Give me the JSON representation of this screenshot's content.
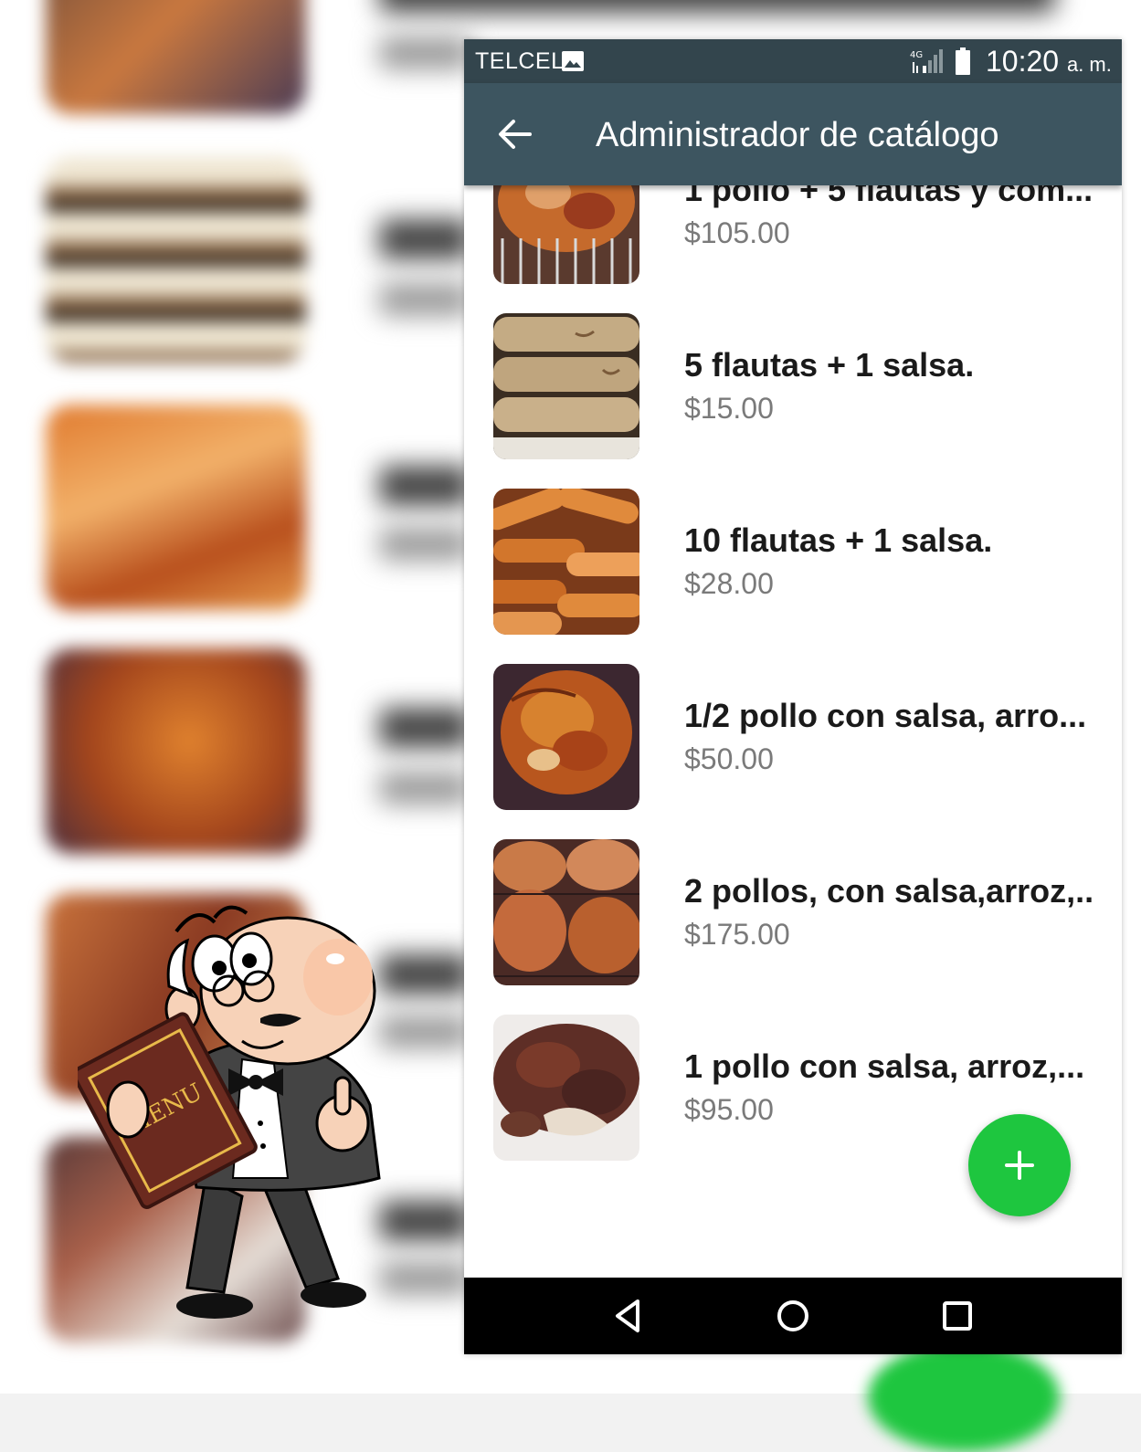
{
  "status_bar": {
    "carrier": "TELCEL",
    "network": "4G",
    "time": "10:20",
    "ampm": "a. m."
  },
  "app_bar": {
    "title": "Administrador de catálogo"
  },
  "catalog": [
    {
      "name": "1 pollo + 5 flautas y com...",
      "price": "$105.00",
      "thumb": "grilled-chicken"
    },
    {
      "name": "5 flautas + 1 salsa.",
      "price": "$15.00",
      "thumb": "flautas"
    },
    {
      "name": "10 flautas + 1 salsa.",
      "price": "$28.00",
      "thumb": "fried-flautas"
    },
    {
      "name": "1/2 pollo con salsa, arro...",
      "price": "$50.00",
      "thumb": "half-chicken"
    },
    {
      "name": "2 pollos, con salsa,arroz,...",
      "price": "$175.00",
      "thumb": "two-chickens"
    },
    {
      "name": "1 pollo con salsa, arroz,...",
      "price": "$95.00",
      "thumb": "chicken-pieces"
    }
  ],
  "mascot": {
    "sign_text": "MENU"
  },
  "colors": {
    "status_bar": "#33454d",
    "app_bar": "#3d5560",
    "fab": "#1ec63f",
    "nav_bar": "#000000"
  }
}
